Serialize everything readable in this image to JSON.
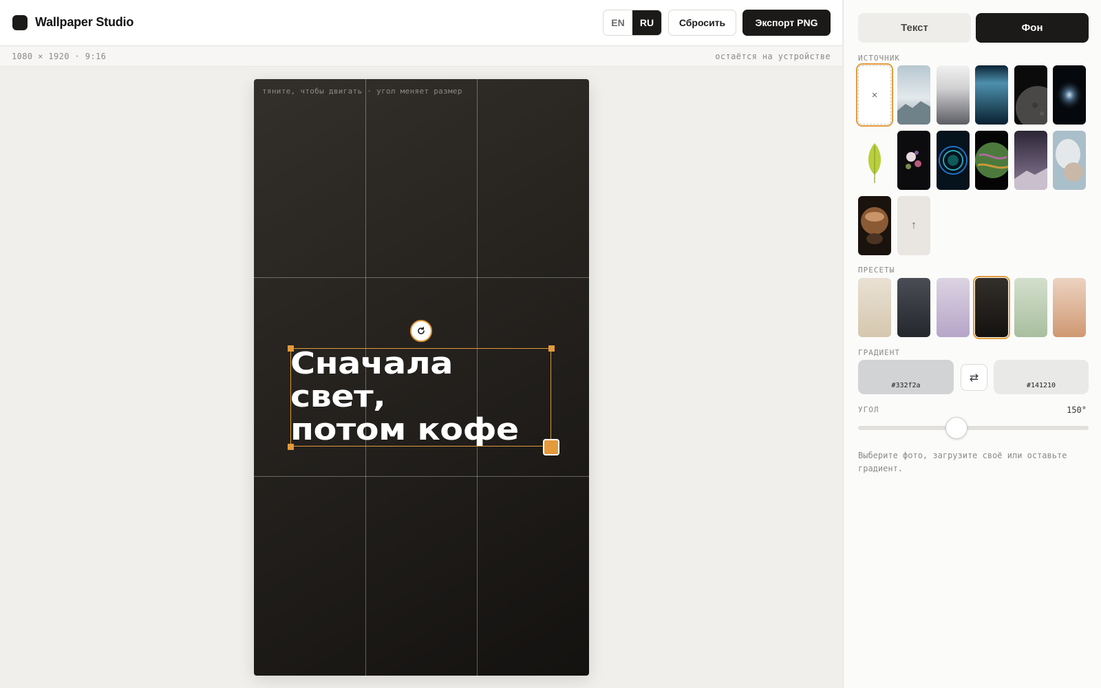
{
  "app": {
    "title": "Wallpaper Studio"
  },
  "header": {
    "languages": [
      {
        "code": "EN",
        "active": false
      },
      {
        "code": "RU",
        "active": true
      }
    ],
    "reset_label": "Сбросить",
    "export_label": "Экспорт PNG"
  },
  "infobar": {
    "dimensions": "1080 × 1920 · 9:16",
    "privacy": "остаётся на устройстве"
  },
  "canvas": {
    "hint": "тяните, чтобы двигать · угол меняет размер",
    "lines": [
      "Сначала",
      "свет,",
      "потом кофе"
    ],
    "rotate_glyph": "↻"
  },
  "panel": {
    "tabs": [
      {
        "label": "Текст",
        "active": false
      },
      {
        "label": "Фон",
        "active": true
      }
    ],
    "source": {
      "label": "ИСТОЧНИК",
      "none_glyph": "×",
      "upload_glyph": "↑",
      "images": [
        "misty-mountains",
        "frosted-forest",
        "ocean-underwater",
        "moon-surface",
        "spiral-galaxy",
        "green-leaf",
        "dark-flowers",
        "blue-rings",
        "marbled-planet",
        "purple-mountain-night",
        "white-smoke",
        "bronze-sphere"
      ]
    },
    "presets": {
      "label": "ПРЕСЕТЫ",
      "colors": [
        "#e4d9c6",
        "#3a3d43",
        "#c7bbd4",
        "#252220",
        "#b9c9b2",
        "#dcb298"
      ],
      "selected_index": 3
    },
    "gradient": {
      "label": "ГРАДИЕНТ",
      "color_a": "#332f2a",
      "color_b": "#141210",
      "swap_glyph": "⇄"
    },
    "angle": {
      "label": "УГОЛ",
      "value": "150°",
      "degrees": 150
    },
    "help": "Выберите фото, загрузите своё или оставьте градиент."
  },
  "colors": {
    "accent": "#e49a3b",
    "dark": "#1b1a18"
  }
}
